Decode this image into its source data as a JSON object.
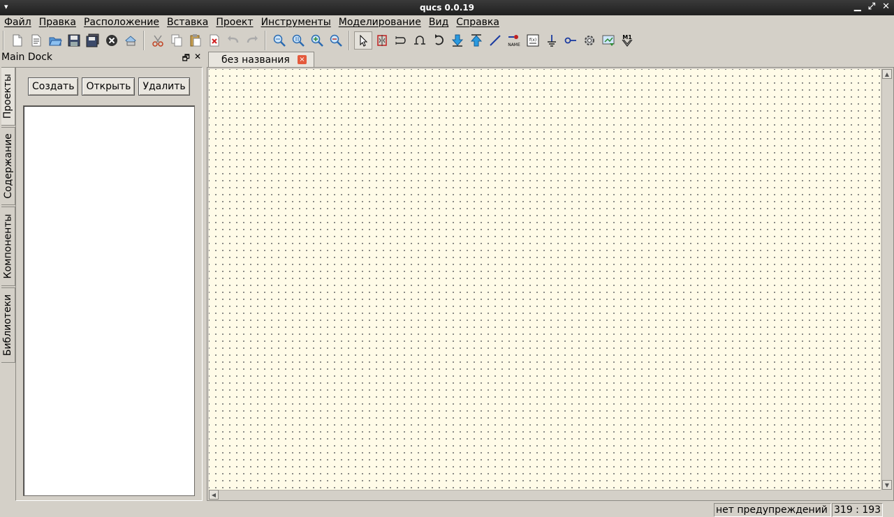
{
  "window": {
    "title": "qucs 0.0.19",
    "menu_glyph": "▾",
    "btn_minimize": "▁",
    "btn_maximize": "⤢",
    "btn_close": "✕"
  },
  "menu": [
    "Файл",
    "Правка",
    "Расположение",
    "Вставка",
    "Проект",
    "Инструменты",
    "Моделирование",
    "Вид",
    "Справка"
  ],
  "toolbar": {
    "file": [
      "new-file-icon",
      "new-text-icon",
      "open-icon",
      "save-icon",
      "save-all-icon",
      "close-doc-icon",
      "print-icon"
    ],
    "edit": [
      "cut-icon",
      "copy-icon",
      "paste-icon",
      "delete-icon",
      "undo-icon",
      "redo-icon"
    ],
    "view": [
      "zoom-fit-icon",
      "zoom-1to1-icon",
      "zoom-in-icon",
      "zoom-out-icon"
    ],
    "tools": [
      "select-icon",
      "mirror-icon",
      "mirror-y-icon",
      "rotate-icon",
      "rotate-left-icon",
      "descend-icon",
      "ascend-icon",
      "wire-icon",
      "wire-label-icon",
      "equation-icon",
      "ground-icon",
      "port-icon",
      "simulate-icon",
      "dpl-icon",
      "marker-icon"
    ],
    "label_name": "NAME",
    "label_eqn": "f(x)",
    "label_marker": "M1"
  },
  "dock": {
    "title": "Main Dock",
    "float_glyph": "🗗",
    "close_glyph": "✕",
    "tabs": [
      "Проекты",
      "Содержание",
      "Компоненты",
      "Библиотеки"
    ],
    "buttons": {
      "create": "Создать",
      "open": "Открыть",
      "delete": "Удалить"
    }
  },
  "editor": {
    "tab_label": "без названия",
    "tab_close": "×"
  },
  "status": {
    "warnings": "нет предупреждений",
    "coords": "319 : 193"
  },
  "colors": {
    "canvas_bg": "#fffbe8",
    "grid_dot": "#6a6a6a",
    "chrome": "#d4d0c8",
    "tab_close": "#e45a3c"
  }
}
